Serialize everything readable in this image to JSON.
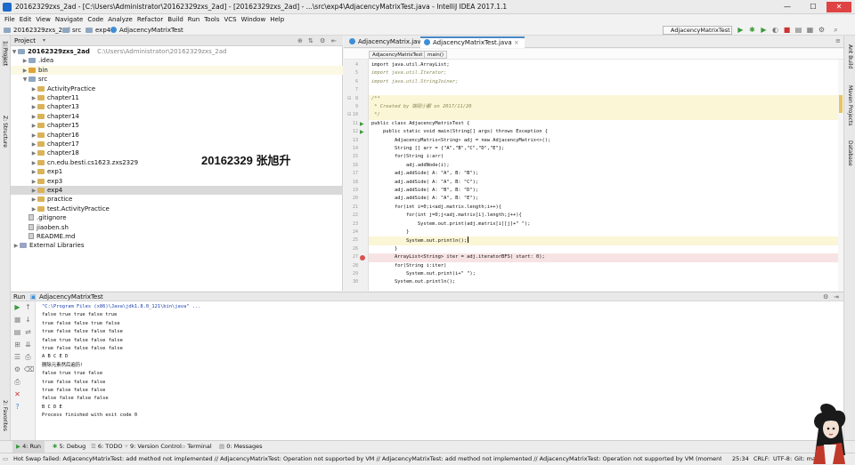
{
  "window": {
    "title": "20162329zxs_2ad - [C:\\Users\\Administrator\\20162329zxs_2ad] - [20162329zxs_2ad] - ...\\src\\exp4\\AdjacencyMatrixTest.java - IntelliJ IDEA 2017.1.1",
    "min": "—",
    "max": "☐",
    "close": "✕"
  },
  "menu": [
    "File",
    "Edit",
    "View",
    "Navigate",
    "Code",
    "Analyze",
    "Refactor",
    "Build",
    "Run",
    "Tools",
    "VCS",
    "Window",
    "Help"
  ],
  "nav": {
    "project": "20162329zxs_2ad",
    "src": "src",
    "pkg": "exp4",
    "file": "AdjacencyMatrixTest"
  },
  "runconfig": "AdjacencyMatrixTest",
  "left_strip": {
    "project": "1: Project",
    "structure": "Z: Structure",
    "favorites": "2: Favorites"
  },
  "right_strip": {
    "antbuild": "Ant Build",
    "maven": "Maven Projects",
    "database": "Database"
  },
  "project_panel": {
    "label": "Project",
    "root": "20162329zxs_2ad",
    "root_path": "C:\\Users\\Administrator\\20162329zxs_2ad",
    "items": [
      {
        "label": ".idea",
        "indent": 1,
        "kind": "folder"
      },
      {
        "label": "bin",
        "indent": 1,
        "kind": "folder-o"
      },
      {
        "label": "src",
        "indent": 1,
        "kind": "folder"
      },
      {
        "label": "ActivityPractice",
        "indent": 2,
        "kind": "folder"
      },
      {
        "label": "chapter11",
        "indent": 2,
        "kind": "folder"
      },
      {
        "label": "chapter13",
        "indent": 2,
        "kind": "folder"
      },
      {
        "label": "chapter14",
        "indent": 2,
        "kind": "folder"
      },
      {
        "label": "chapter15",
        "indent": 2,
        "kind": "folder"
      },
      {
        "label": "chapter16",
        "indent": 2,
        "kind": "folder"
      },
      {
        "label": "chapter17",
        "indent": 2,
        "kind": "folder"
      },
      {
        "label": "chapter18",
        "indent": 2,
        "kind": "folder"
      },
      {
        "label": "cn.edu.besti.cs1623.zxs2329",
        "indent": 2,
        "kind": "folder"
      },
      {
        "label": "exp1",
        "indent": 2,
        "kind": "folder"
      },
      {
        "label": "exp3",
        "indent": 2,
        "kind": "folder"
      },
      {
        "label": "exp4",
        "indent": 2,
        "kind": "folder"
      },
      {
        "label": "practice",
        "indent": 2,
        "kind": "folder"
      },
      {
        "label": "test.ActivityPractice",
        "indent": 2,
        "kind": "folder"
      },
      {
        "label": ".gitignore",
        "indent": 1,
        "kind": "file"
      },
      {
        "label": "jiaoben.sh",
        "indent": 1,
        "kind": "file"
      },
      {
        "label": "README.md",
        "indent": 1,
        "kind": "file"
      },
      {
        "label": "External Libraries",
        "indent": 0,
        "kind": "lib"
      }
    ]
  },
  "watermark": "20162329 张旭升",
  "editor": {
    "tabs": [
      "AdjacencyMatrix.java",
      "AdjacencyMatrixTest.java"
    ],
    "breadcrumb": [
      "AdjacencyMatrixTest",
      "main()"
    ],
    "lines": [
      {
        "n": "4",
        "t": "import java.util.ArrayList;",
        "s": ""
      },
      {
        "n": "5",
        "t": "import java.util.Iterator;",
        "s": "cm"
      },
      {
        "n": "6",
        "t": "import java.util.StringJoiner;",
        "s": "cm"
      },
      {
        "n": "7",
        "t": "",
        "s": ""
      },
      {
        "n": "8",
        "t": "/**",
        "s": "y cm"
      },
      {
        "n": "9",
        "t": " * Created by 端砚小鄞 on 2017/11/20",
        "s": "y cm"
      },
      {
        "n": "10",
        "t": " */",
        "s": "y cm"
      },
      {
        "n": "11",
        "t": "public class AdjacencyMatrixTest {",
        "s": ""
      },
      {
        "n": "12",
        "t": "    public static void main(String[] args) throws Exception {",
        "s": ""
      },
      {
        "n": "13",
        "t": "        AdjacencyMatrix<String> adj = new AdjacencyMatrix<>();",
        "s": ""
      },
      {
        "n": "14",
        "t": "        String [] arr = {\"A\",\"B\",\"C\",\"D\",\"E\"};",
        "s": ""
      },
      {
        "n": "15",
        "t": "        for(String i:arr)",
        "s": ""
      },
      {
        "n": "16",
        "t": "            adj.addNode(i);",
        "s": ""
      },
      {
        "n": "17",
        "t": "        adj.addSide( A: \"A\", B: \"B\");",
        "s": ""
      },
      {
        "n": "18",
        "t": "        adj.addSide( A: \"A\", B: \"C\");",
        "s": ""
      },
      {
        "n": "19",
        "t": "        adj.addSide( A: \"B\", B: \"D\");",
        "s": ""
      },
      {
        "n": "20",
        "t": "        adj.addSide( A: \"A\", B: \"E\");",
        "s": ""
      },
      {
        "n": "21",
        "t": "        for(int i=0;i<adj.matrix.length;i++){",
        "s": ""
      },
      {
        "n": "22",
        "t": "            for(int j=0;j<adj.matrix[i].length;j++){",
        "s": ""
      },
      {
        "n": "23",
        "t": "                System.out.print(adj.matrix[i][j]+\" \");",
        "s": ""
      },
      {
        "n": "24",
        "t": "            }",
        "s": ""
      },
      {
        "n": "25",
        "t": "            System.out.println();",
        "s": "y"
      },
      {
        "n": "26",
        "t": "        }",
        "s": ""
      },
      {
        "n": "27",
        "t": "        ArrayList<String> iter = adj.iteratorBFS( start: 0);",
        "s": "r"
      },
      {
        "n": "28",
        "t": "        for(String i:iter)",
        "s": ""
      },
      {
        "n": "29",
        "t": "            System.out.print(i+\" \");",
        "s": ""
      },
      {
        "n": "30",
        "t": "        System.out.println();",
        "s": ""
      }
    ]
  },
  "run_panel": {
    "label": "Run",
    "config": "AdjacencyMatrixTest",
    "output": [
      "\"C:\\Program Files (x86)\\Java\\jdk1.8.0_121\\bin\\java\" ...",
      "false true true false true",
      "true false false true false",
      "true false false false false",
      "false true false false false",
      "true false false false false",
      "A B C E D",
      "删除元素然后遍历!",
      "false true true false",
      "true false false false",
      "true false false false",
      "false false false false",
      "B C D E",
      "Process finished with exit code 0"
    ]
  },
  "bottom_tabs": [
    "4: Run",
    "5: Debug",
    "6: TODO",
    "9: Version Control",
    "Terminal",
    "0: Messages"
  ],
  "status": {
    "message": "Hot Swap failed: AdjacencyMatrixTest: add method not implemented // AdjacencyMatrixTest: Operation not supported by VM // AdjacencyMatrixTest: add method not implemented // AdjacencyMatrixTest: Operation not supported by VM (moments ago)",
    "pos": "25:34",
    "lineend": "CRLF:",
    "encoding": "UTF-8:",
    "git": "Git: maste"
  }
}
